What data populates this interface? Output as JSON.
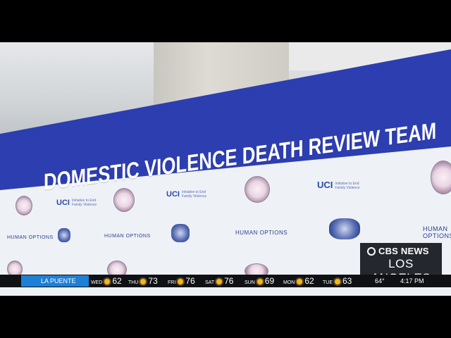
{
  "banner": {
    "headline": "DOMESTIC VIOLENCE DEATH REVIEW TEAM",
    "uci_logo": "UCI",
    "uci_tagline": "Initiative to End Family Violence",
    "ho_logo": "HUMAN OPTIONS",
    "colors": {
      "banner_blue": "#2d3eb0",
      "logo_blue": "#2a4aa7"
    }
  },
  "station": {
    "brand": "CBS NEWS",
    "city": "LOS ANGELES"
  },
  "ticker": {
    "location": "LA PUENTE",
    "forecast": [
      {
        "day": "WED",
        "temp": "62"
      },
      {
        "day": "THU",
        "temp": "73"
      },
      {
        "day": "FRI",
        "temp": "76"
      },
      {
        "day": "SAT",
        "temp": "76"
      },
      {
        "day": "SUN",
        "temp": "69"
      },
      {
        "day": "MON",
        "temp": "62"
      },
      {
        "day": "TUE",
        "temp": "63"
      }
    ],
    "current_temp": "64°",
    "time": "4:17 PM"
  }
}
